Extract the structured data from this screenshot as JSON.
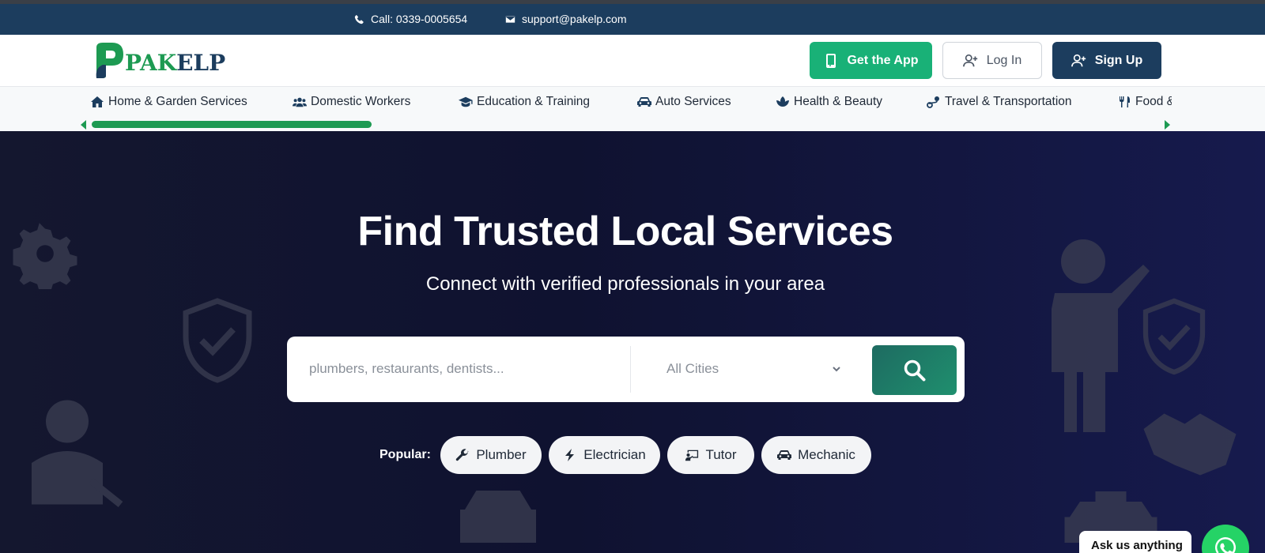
{
  "topbar": {
    "phone": "Call: 0339-0005654",
    "email": "support@pakelp.com"
  },
  "header": {
    "logo_text_green": "PAK",
    "logo_text_blue": "ELP",
    "buttons": {
      "get_app": "Get the App",
      "login": "Log In",
      "signup": "Sign Up"
    }
  },
  "categories": [
    {
      "label": "Home & Garden Services",
      "icon": "home-icon"
    },
    {
      "label": "Domestic Workers",
      "icon": "users-icon"
    },
    {
      "label": "Education & Training",
      "icon": "graduation-cap-icon"
    },
    {
      "label": "Auto Services",
      "icon": "car-icon"
    },
    {
      "label": "Health & Beauty",
      "icon": "spa-icon"
    },
    {
      "label": "Travel & Transportation",
      "icon": "route-icon"
    },
    {
      "label": "Food & Dining",
      "icon": "utensils-icon"
    }
  ],
  "hero": {
    "title": "Find Trusted Local Services",
    "subtitle": "Connect with verified professionals in your area",
    "search_placeholder": "plumbers, restaurants, dentists...",
    "city_selected": "All Cities",
    "popular_label": "Popular:",
    "popular": [
      {
        "label": "Plumber",
        "icon": "wrench-icon"
      },
      {
        "label": "Electrician",
        "icon": "bolt-icon"
      },
      {
        "label": "Tutor",
        "icon": "chalkboard-teacher-icon"
      },
      {
        "label": "Mechanic",
        "icon": "car-icon"
      }
    ]
  },
  "chat": {
    "ask_label": "Ask us anything"
  },
  "colors": {
    "brand_navy": "#1c3d5e",
    "brand_green": "#1d9a52",
    "app_button": "#19b177",
    "whatsapp": "#25d366"
  }
}
